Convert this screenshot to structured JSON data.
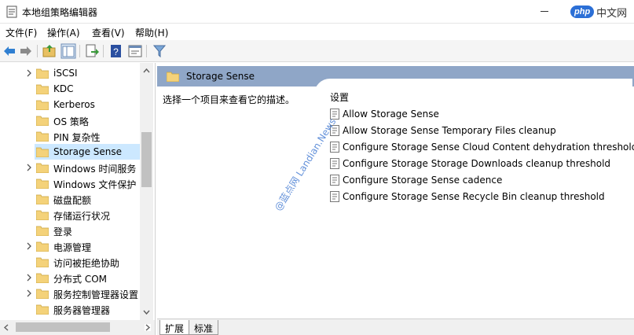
{
  "window": {
    "title": "本地组策略编辑器",
    "brand_badge": "php",
    "brand_text": "中文网"
  },
  "menu": [
    "文件(F)",
    "操作(A)",
    "查看(V)",
    "帮助(H)"
  ],
  "toolbar": {
    "buttons": [
      "back-icon",
      "forward-icon",
      "up-folder-icon",
      "show-hide-tree-icon",
      "export-list-icon",
      "help-icon",
      "properties-icon",
      "filter-icon"
    ]
  },
  "tree": {
    "items": [
      {
        "label": "iSCSI",
        "expandable": true
      },
      {
        "label": "KDC",
        "expandable": false
      },
      {
        "label": "Kerberos",
        "expandable": false
      },
      {
        "label": "OS 策略",
        "expandable": false
      },
      {
        "label": "PIN 复杂性",
        "expandable": false
      },
      {
        "label": "Storage Sense",
        "expandable": false,
        "selected": true
      },
      {
        "label": "Windows 时间服务",
        "expandable": true
      },
      {
        "label": "Windows 文件保护",
        "expandable": false
      },
      {
        "label": "磁盘配额",
        "expandable": false
      },
      {
        "label": "存储运行状况",
        "expandable": false
      },
      {
        "label": "登录",
        "expandable": false
      },
      {
        "label": "电源管理",
        "expandable": true
      },
      {
        "label": "访问被拒绝协助",
        "expandable": false
      },
      {
        "label": "分布式 COM",
        "expandable": true
      },
      {
        "label": "服务控制管理器设置",
        "expandable": true
      },
      {
        "label": "服务器管理器",
        "expandable": false
      }
    ]
  },
  "details": {
    "header": "Storage Sense",
    "description": "选择一个项目来查看它的描述。",
    "settings_heading": "设置",
    "settings": [
      "Allow Storage Sense",
      "Allow Storage Sense Temporary Files cleanup",
      "Configure Storage Sense Cloud Content dehydration threshold",
      "Configure Storage Storage Downloads cleanup threshold",
      "Configure Storage Sense cadence",
      "Configure Storage Sense Recycle Bin cleanup threshold"
    ]
  },
  "tabs": [
    "扩展",
    "标准"
  ],
  "watermark": "@蓝点网 Landian.News",
  "colors": {
    "header_band": "#8fa6c7",
    "selection": "#cce8ff",
    "folder": "#e8c062"
  }
}
